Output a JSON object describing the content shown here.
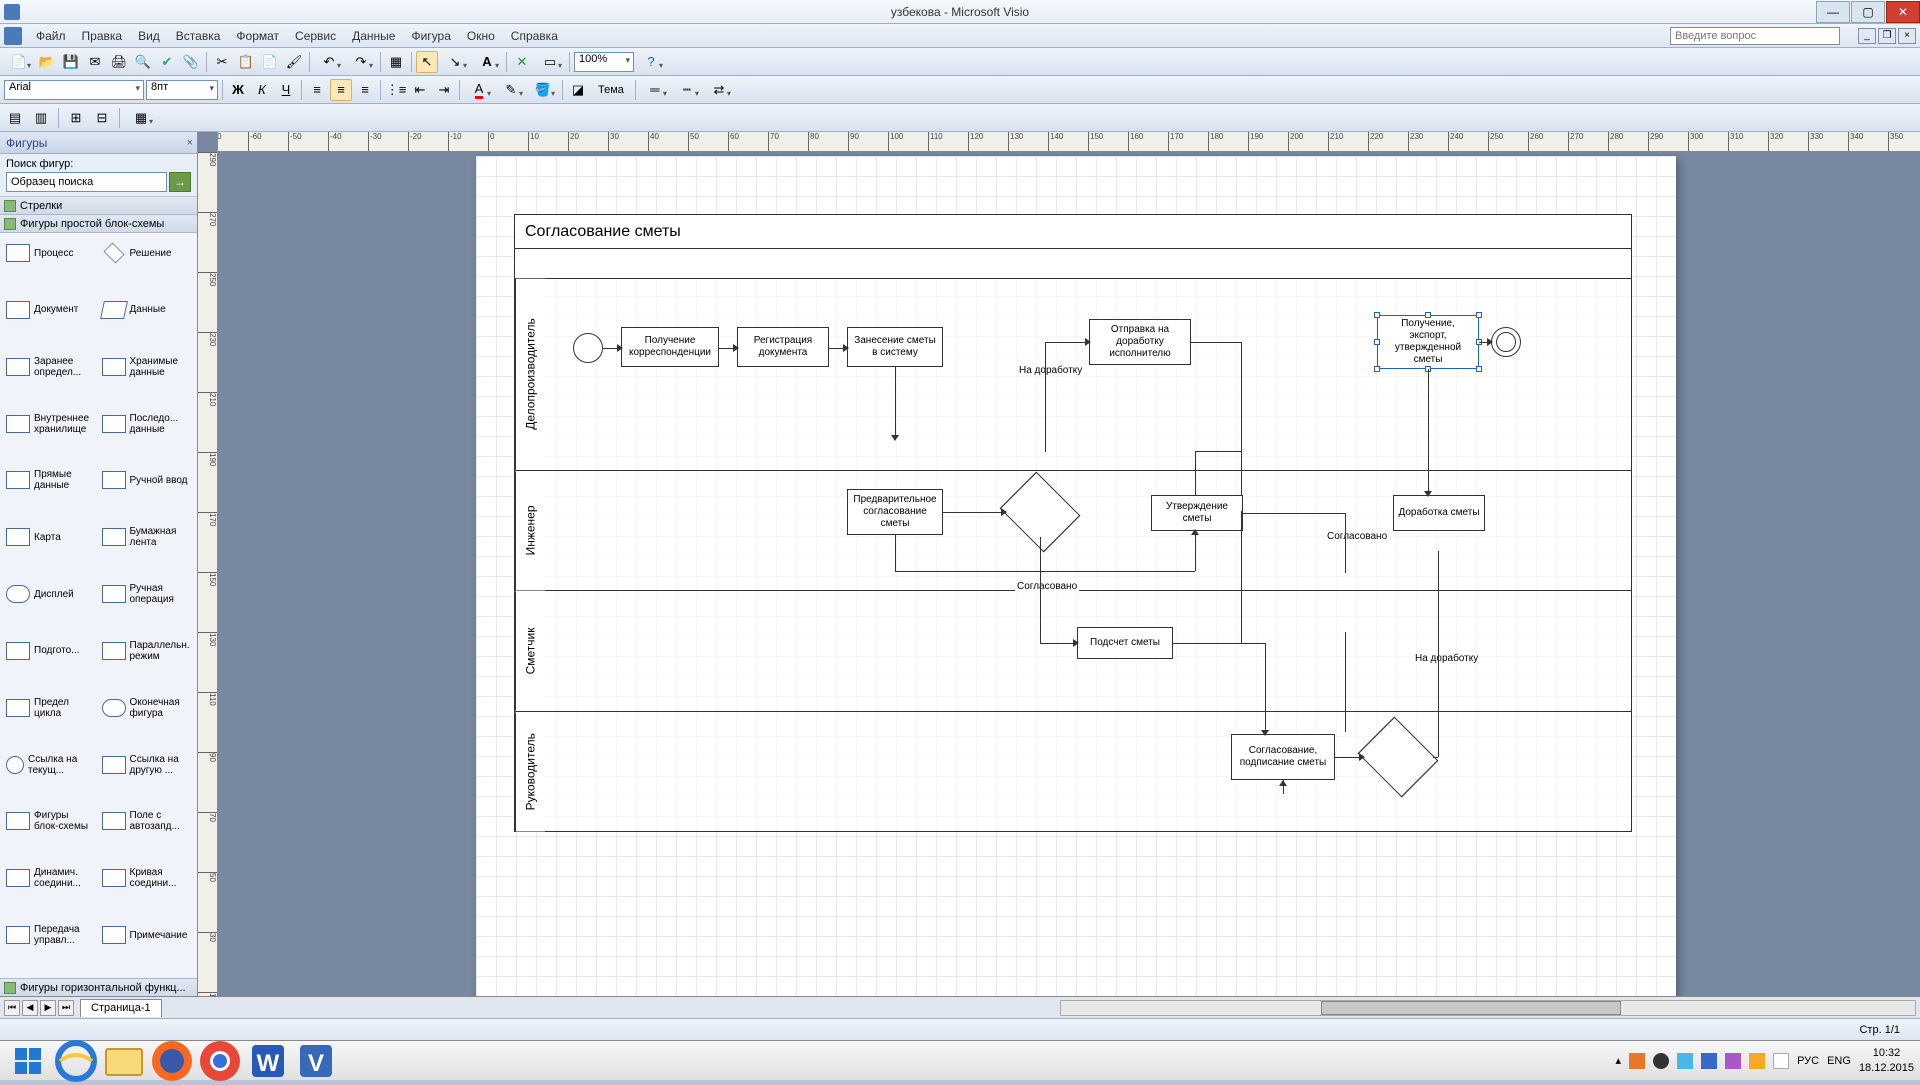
{
  "titlebar": {
    "title": "узбекова - Microsoft Visio"
  },
  "menu": {
    "items": [
      "Файл",
      "Правка",
      "Вид",
      "Вставка",
      "Формат",
      "Сервис",
      "Данные",
      "Фигура",
      "Окно",
      "Справка"
    ],
    "search_placeholder": "Введите вопрос"
  },
  "toolbar": {
    "font": "Arial",
    "size": "8пт",
    "zoom": "100%",
    "theme_label": "Тема"
  },
  "shapes_panel": {
    "title": "Фигуры",
    "search_label": "Поиск фигур:",
    "search_placeholder": "Образец поиска",
    "cat1": "Стрелки",
    "cat2": "Фигуры простой блок-схемы",
    "footer": "Фигуры горизонтальной функц...",
    "shapes": [
      {
        "label": "Процесс",
        "cls": ""
      },
      {
        "label": "Решение",
        "cls": "diamond"
      },
      {
        "label": "Документ",
        "cls": ""
      },
      {
        "label": "Данные",
        "cls": "para"
      },
      {
        "label": "Заранее определ...",
        "cls": ""
      },
      {
        "label": "Хранимые данные",
        "cls": ""
      },
      {
        "label": "Внутреннее хранилище",
        "cls": ""
      },
      {
        "label": "Последо... данные",
        "cls": ""
      },
      {
        "label": "Прямые данные",
        "cls": ""
      },
      {
        "label": "Ручной ввод",
        "cls": ""
      },
      {
        "label": "Карта",
        "cls": ""
      },
      {
        "label": "Бумажная лента",
        "cls": ""
      },
      {
        "label": "Дисплей",
        "cls": "round"
      },
      {
        "label": "Ручная операция",
        "cls": ""
      },
      {
        "label": "Подгото...",
        "cls": ""
      },
      {
        "label": "Параллельн. режим",
        "cls": ""
      },
      {
        "label": "Предел цикла",
        "cls": ""
      },
      {
        "label": "Оконечная фигура",
        "cls": "round"
      },
      {
        "label": "Ссылка на текущ...",
        "cls": "circle"
      },
      {
        "label": "Ссылка на другую ...",
        "cls": ""
      },
      {
        "label": "Фигуры блок-схемы",
        "cls": ""
      },
      {
        "label": "Поле с автозапд...",
        "cls": ""
      },
      {
        "label": "Динамич. соедини...",
        "cls": ""
      },
      {
        "label": "Кривая соедини...",
        "cls": ""
      },
      {
        "label": "Передача управл...",
        "cls": ""
      },
      {
        "label": "Примечание",
        "cls": ""
      }
    ]
  },
  "diagram": {
    "title": "Согласование сметы",
    "lanes": [
      "Делопроизводитель",
      "Инженер",
      "Сметчик",
      "Руководитель"
    ],
    "boxes": {
      "b1": "Получение корреспонденции",
      "b2": "Регистрация документа",
      "b3": "Занесение сметы в систему",
      "b4": "Отправка на доработку исполнителю",
      "b5": "Получение, экспорт, утвержденной сметы",
      "b6": "Предварительное согласование сметы",
      "b7": "Утверждение сметы",
      "b8": "Доработка сметы",
      "b9": "Подсчет сметы",
      "b10": "Согласование, подписание сметы"
    },
    "labels": {
      "l1": "На доработку",
      "l2": "Согласовано",
      "l3": "Согласовано",
      "l4": "На доработку"
    }
  },
  "pagetabs": {
    "tab1": "Страница-1"
  },
  "statusbar": {
    "page": "Стр. 1/1"
  },
  "taskbar": {
    "lang": "РУС",
    "input": "ENG",
    "time": "10:32",
    "date": "18.12.2015"
  }
}
